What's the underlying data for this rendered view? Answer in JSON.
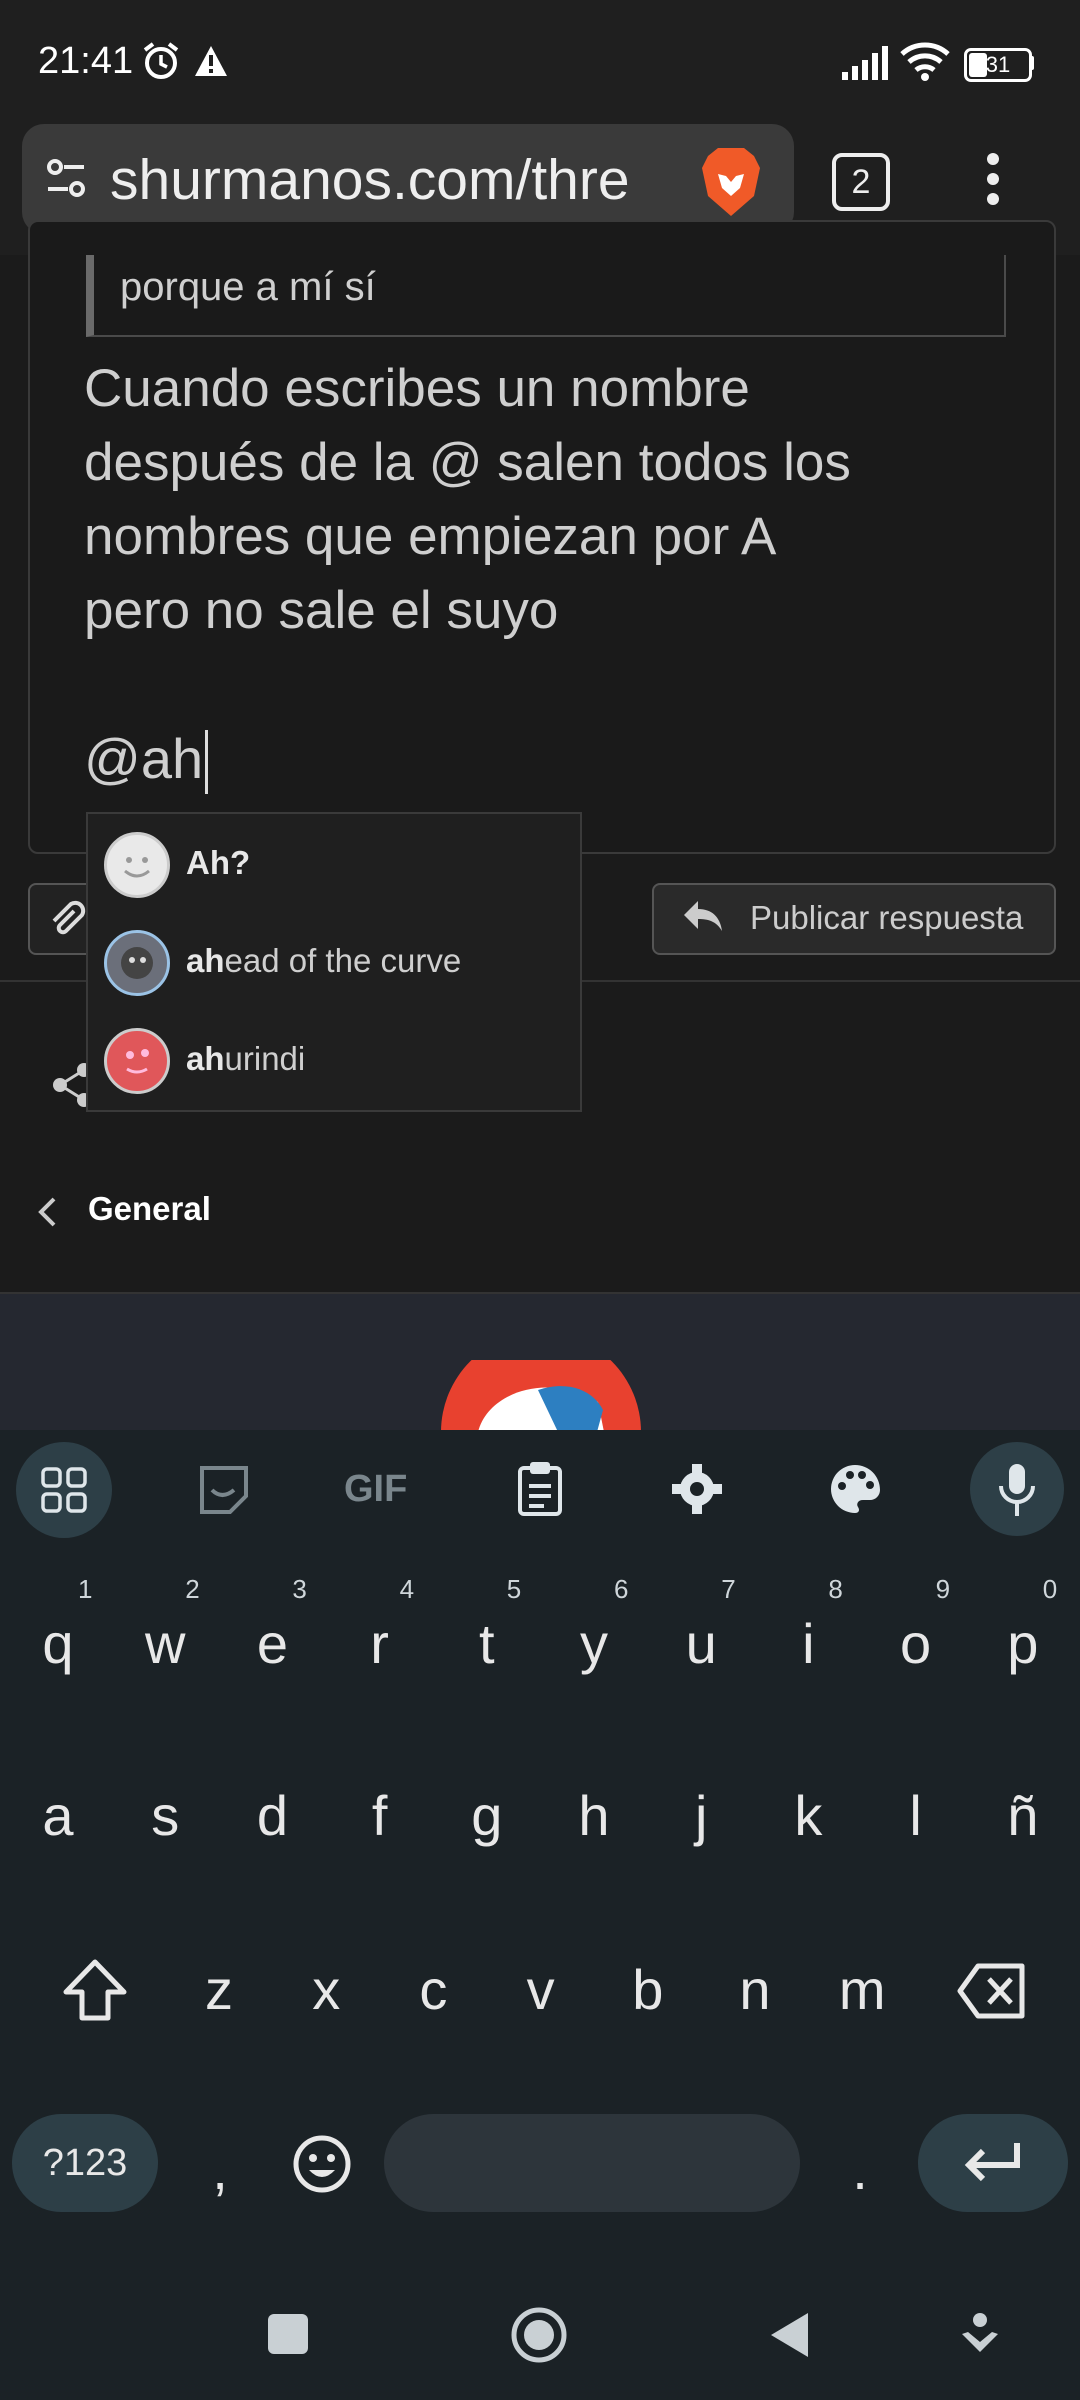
{
  "status": {
    "time": "21:41",
    "battery": "31",
    "alarm_icon": "alarm-clock-icon",
    "warning_icon": "warning-icon",
    "signal_icon": "signal-bars-icon",
    "wifi_icon": "wifi-icon"
  },
  "browser": {
    "url": "shurmanos.com/thre",
    "tab_count": "2"
  },
  "editor": {
    "quoted_text": "porque a mí sí",
    "body_lines": [
      "Cuando escribes un nombre",
      "después de la @ salen todos los",
      "nombres que empiezan por A",
      "pero no sale el suyo"
    ],
    "mention_input": "@ah"
  },
  "autocomplete": [
    {
      "match": "Ah?",
      "rest": ""
    },
    {
      "match": "ah",
      "rest": "ead of the curve"
    },
    {
      "match": "ah",
      "rest": "urindi"
    }
  ],
  "actions": {
    "publish_label": "Publicar respuesta"
  },
  "nav": {
    "breadcrumb": "General"
  },
  "keyboard": {
    "toolbar_gif": "GIF",
    "row1": [
      "q",
      "w",
      "e",
      "r",
      "t",
      "y",
      "u",
      "i",
      "o",
      "p"
    ],
    "row1_hints": [
      "1",
      "2",
      "3",
      "4",
      "5",
      "6",
      "7",
      "8",
      "9",
      "0"
    ],
    "row2": [
      "a",
      "s",
      "d",
      "f",
      "g",
      "h",
      "j",
      "k",
      "l",
      "ñ"
    ],
    "row3": [
      "z",
      "x",
      "c",
      "v",
      "b",
      "n",
      "m"
    ],
    "symbols_label": "?123",
    "comma": ",",
    "period": "."
  },
  "colors": {
    "accent_keyboard": "#2d3f47",
    "avatar1": "#e9e9e9",
    "avatar2": "#6b6f7a",
    "avatar3": "#e0575a",
    "brave": "#f05a28"
  }
}
